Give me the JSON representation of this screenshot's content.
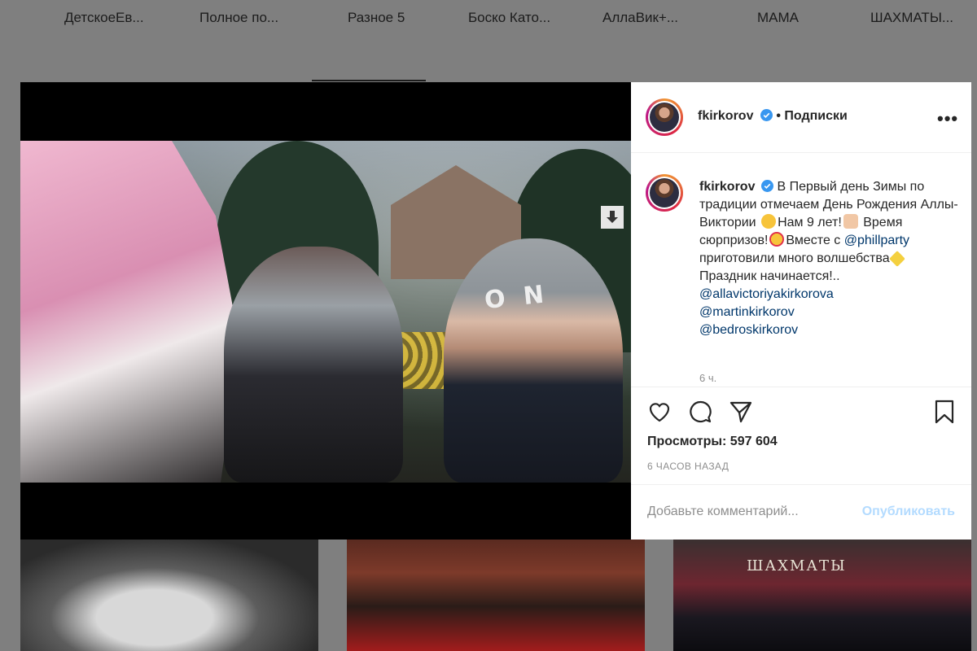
{
  "highlights": [
    "ДетскоеЕв...",
    "Полное по...",
    "Разное 5",
    "Боско Като...",
    "АллаВик+...",
    "МАМА",
    "ШАХМАТЫ..."
  ],
  "post": {
    "username": "fkirkorov",
    "follow_status": "• Подписки",
    "more_label": "•••",
    "caption": {
      "username": "fkirkorov",
      "line1": "В Первый день Зимы по традиции отмечаем День Рождения Аллы-Виктории",
      "line2": "Нам 9 лет!",
      "line3": "Время сюрпризов!",
      "line4": "Вместе с",
      "mention_inline": "@phillparty",
      "line5": "приготовили много волшебства",
      "line6": "Праздник начинается!..",
      "mentions": [
        "@allavictoriyakirkorova",
        "@martinkirkorov",
        "@bedroskirkorov"
      ]
    },
    "caption_time": "6 ч.",
    "views_label": "Просмотры:",
    "views_value": "597 604",
    "post_time": "6 ЧАСОВ НАЗАД",
    "comment_placeholder": "Добавьте комментарий...",
    "publish_label": "Опубликовать"
  },
  "video": {
    "hat_text": "O N"
  },
  "tiles": {
    "tile3_label": "ШАХМАТЫ"
  },
  "colors": {
    "verified": "#3897f0",
    "link": "#00376b",
    "publish_disabled": "#b3dbff"
  },
  "icons": [
    "heart-icon",
    "comment-icon",
    "share-icon",
    "bookmark-icon",
    "download-icon",
    "user-tag-icon",
    "mute-icon",
    "verified-icon"
  ]
}
